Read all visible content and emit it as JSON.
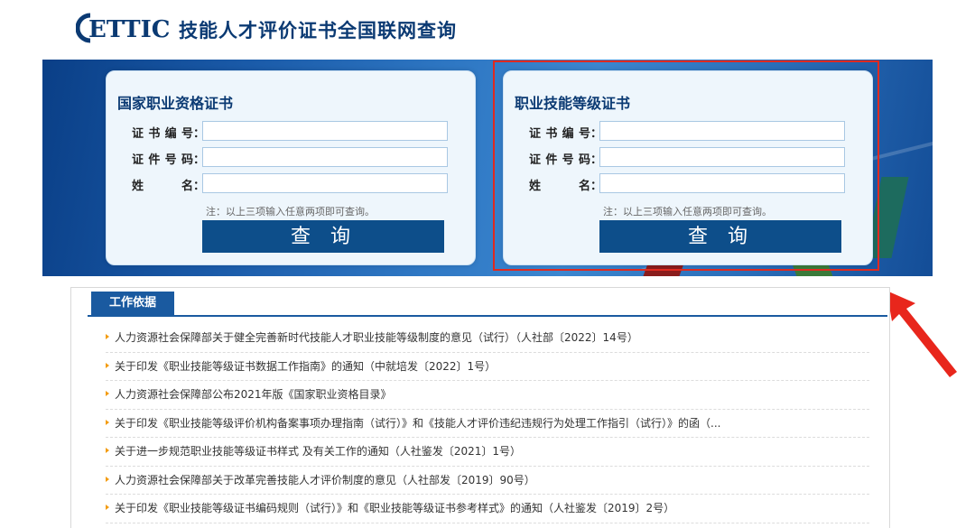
{
  "header": {
    "logo_text": "ETTIC",
    "title": "技能人才评价证书全国联网查询"
  },
  "panels": [
    {
      "title": "国家职业资格证书",
      "fields": [
        {
          "label": "证书编号",
          "value": ""
        },
        {
          "label": "证件号码",
          "value": ""
        },
        {
          "label": "姓名",
          "value": ""
        }
      ],
      "note": "注：以上三项输入任意两项即可查询。",
      "button": "查询"
    },
    {
      "title": "职业技能等级证书",
      "fields": [
        {
          "label": "证书编号",
          "value": ""
        },
        {
          "label": "证件号码",
          "value": ""
        },
        {
          "label": "姓名",
          "value": ""
        }
      ],
      "note": "注：以上三项输入任意两项即可查询。",
      "button": "查询"
    }
  ],
  "colon": "：",
  "section": {
    "tab": "工作依据",
    "items": [
      "人力资源社会保障部关于健全完善新时代技能人才职业技能等级制度的意见（试行）（人社部〔2022〕14号）",
      "关于印发《职业技能等级证书数据工作指南》的通知（中就培发〔2022〕1号）",
      "人力资源社会保障部公布2021年版《国家职业资格目录》",
      "关于印发《职业技能等级评价机构备案事项办理指南（试行）》和《技能人才评价违纪违规行为处理工作指引（试行）》的函（...",
      "关于进一步规范职业技能等级证书样式 及有关工作的通知（人社鉴发〔2021〕1号）",
      "人力资源社会保障部关于改革完善技能人才评价制度的意见（人社部发〔2019〕90号）",
      "关于印发《职业技能等级证书编码规则（试行）》和《职业技能等级证书参考样式》的通知（人社鉴发〔2019〕2号）"
    ]
  },
  "colors": {
    "brand": "#0b3a73",
    "button": "#0d4e8a",
    "highlight": "#e02a20",
    "bullet": "#f39c12"
  }
}
